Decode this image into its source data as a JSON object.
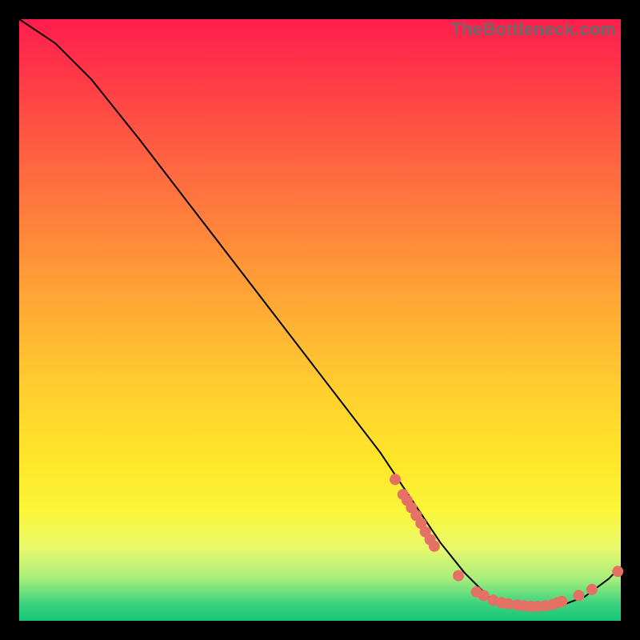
{
  "watermark": "TheBottleneck.com",
  "chart_data": {
    "type": "line",
    "title": "",
    "xlabel": "",
    "ylabel": "",
    "xlim": [
      0,
      100
    ],
    "ylim": [
      0,
      100
    ],
    "series": [
      {
        "name": "curve",
        "x": [
          0,
          6,
          12,
          20,
          30,
          40,
          50,
          60,
          66,
          70,
          74,
          78,
          82,
          86,
          90,
          94,
          98,
          100
        ],
        "y": [
          100,
          96,
          90,
          80,
          67,
          54,
          41,
          28,
          19,
          13,
          8,
          4,
          2.5,
          2,
          2.5,
          4,
          7,
          9
        ]
      }
    ],
    "markers": [
      {
        "x": 62.5,
        "y": 23.5
      },
      {
        "x": 63.8,
        "y": 21.0
      },
      {
        "x": 64.5,
        "y": 20.0
      },
      {
        "x": 65.2,
        "y": 18.8
      },
      {
        "x": 66.0,
        "y": 17.5
      },
      {
        "x": 66.8,
        "y": 16.2
      },
      {
        "x": 67.5,
        "y": 14.8
      },
      {
        "x": 68.3,
        "y": 13.5
      },
      {
        "x": 69.0,
        "y": 12.4
      },
      {
        "x": 73.0,
        "y": 7.5
      },
      {
        "x": 76.0,
        "y": 4.8
      },
      {
        "x": 77.2,
        "y": 4.2
      },
      {
        "x": 78.8,
        "y": 3.4
      },
      {
        "x": 80.2,
        "y": 3.0
      },
      {
        "x": 81.3,
        "y": 2.8
      },
      {
        "x": 82.8,
        "y": 2.6
      },
      {
        "x": 83.9,
        "y": 2.5
      },
      {
        "x": 85.0,
        "y": 2.4
      },
      {
        "x": 86.2,
        "y": 2.4
      },
      {
        "x": 87.5,
        "y": 2.5
      },
      {
        "x": 88.7,
        "y": 2.7
      },
      {
        "x": 89.5,
        "y": 3.0
      },
      {
        "x": 90.2,
        "y": 3.2
      },
      {
        "x": 93.0,
        "y": 4.2
      },
      {
        "x": 95.2,
        "y": 5.2
      },
      {
        "x": 99.5,
        "y": 8.2
      }
    ],
    "style": {
      "line_color": "#000000",
      "line_width": 2,
      "marker_color": "#e47066",
      "marker_radius": 7
    }
  }
}
